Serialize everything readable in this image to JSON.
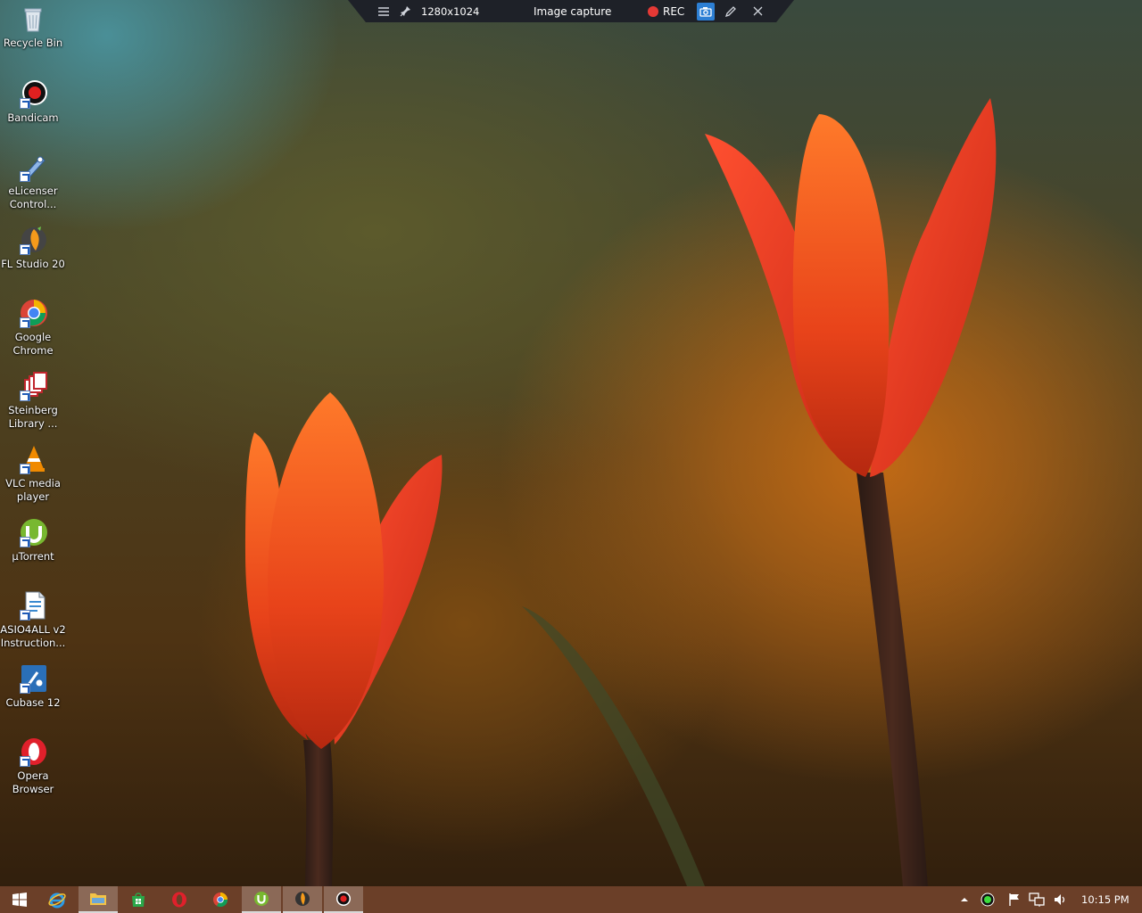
{
  "capture_toolbar": {
    "resolution": "1280x1024",
    "mode": "Image capture",
    "rec_label": "REC"
  },
  "desktop_icons": [
    {
      "label": "Recycle Bin",
      "icon": "recycle-bin-icon"
    },
    {
      "label": "Bandicam",
      "icon": "bandicam-icon"
    },
    {
      "label": "eLicenser\nControl...",
      "icon": "elicenser-icon"
    },
    {
      "label": "FL Studio 20",
      "icon": "fl-studio-icon"
    },
    {
      "label": "Google\nChrome",
      "icon": "chrome-icon"
    },
    {
      "label": "Steinberg\nLibrary ...",
      "icon": "steinberg-library-icon"
    },
    {
      "label": "VLC media\nplayer",
      "icon": "vlc-icon"
    },
    {
      "label": "µTorrent",
      "icon": "utorrent-icon"
    },
    {
      "label": "ASIO4ALL v2\nInstruction...",
      "icon": "asio4all-doc-icon"
    },
    {
      "label": "Cubase 12",
      "icon": "cubase-icon"
    },
    {
      "label": "Opera\nBrowser",
      "icon": "opera-icon"
    }
  ],
  "taskbar": {
    "pinned": [
      "start-icon",
      "internet-explorer-icon",
      "file-explorer-icon",
      "store-icon",
      "opera-icon",
      "chrome-icon",
      "utorrent-icon",
      "fl-studio-icon",
      "bandicam-icon"
    ],
    "clock": "10:15 PM"
  },
  "colors": {
    "taskbar": "#6b3f28",
    "capture_bar": "#1e2128",
    "rec": "#e53935",
    "camera_active": "#2d7fd4"
  }
}
